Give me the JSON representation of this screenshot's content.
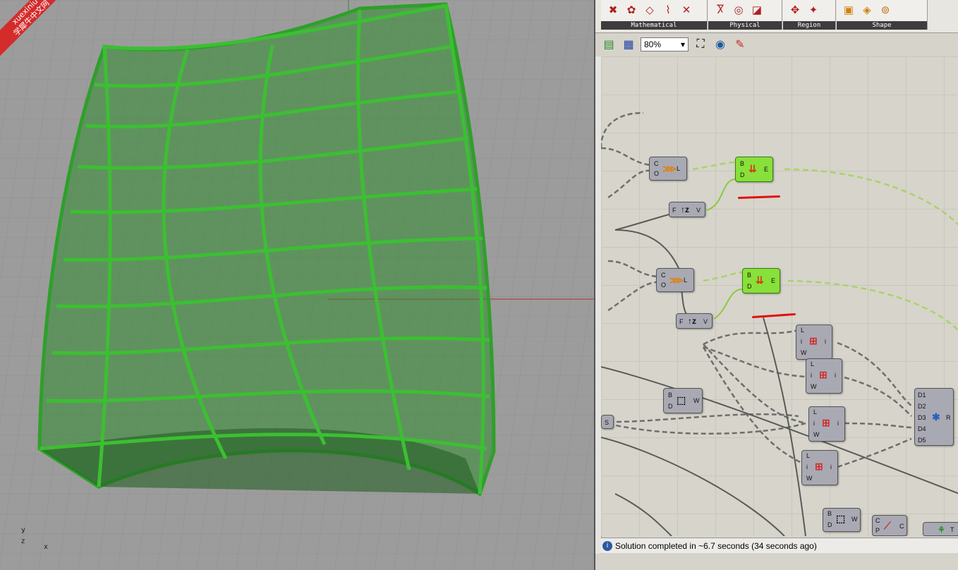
{
  "watermark": {
    "line1": "xuexiniu",
    "line2": "学犀牛中文网"
  },
  "viewport": {
    "axis_y": "y",
    "axis_z": "z",
    "axis_x": "x"
  },
  "ribbon": {
    "groups": [
      {
        "label": "Mathematical",
        "icons": [
          "bounce-icon",
          "hinge-icon",
          "plane-icon",
          "angle-icon",
          "hinge2-icon"
        ]
      },
      {
        "label": "Physical",
        "icons": [
          "rope-icon",
          "eye-icon",
          "box-icon"
        ]
      },
      {
        "label": "Region",
        "icons": [
          "region1-icon",
          "region2-icon"
        ]
      },
      {
        "label": "Shape",
        "icons": [
          "cube-icon",
          "box2-icon",
          "circles-icon"
        ]
      }
    ]
  },
  "toolbar": {
    "zoom_value": "80%"
  },
  "components": {
    "anchor1": {
      "in1": "C",
      "in2": "O",
      "out": "L"
    },
    "anchor2": {
      "in1": "C",
      "in2": "O",
      "out": "L"
    },
    "unitz1": {
      "in": "F",
      "out": "V"
    },
    "unitz2": {
      "in": "F",
      "out": "V"
    },
    "load1": {
      "in1": "B",
      "in2": "D",
      "out": "E"
    },
    "load2": {
      "in1": "B",
      "in2": "D",
      "out": "E"
    },
    "box1": {
      "in1": "B",
      "in2": "D",
      "out": "W"
    },
    "box2": {
      "in1": "B",
      "in2": "D",
      "out": "W"
    },
    "interp1": {
      "in1": "L",
      "in2": "i",
      "in3": "W",
      "out": "i"
    },
    "interp2": {
      "in1": "L",
      "in2": "i",
      "in3": "W",
      "out": "i"
    },
    "interp3": {
      "in1": "L",
      "in2": "i",
      "in3": "W",
      "out": "i"
    },
    "interp4": {
      "in1": "L",
      "in2": "i",
      "in3": "W",
      "out": "i"
    },
    "merge": {
      "in1": "D1",
      "in2": "D2",
      "in3": "D3",
      "in4": "D4",
      "in5": "D5",
      "out": "R"
    },
    "s_param": {
      "label": "S"
    },
    "bottom1": {
      "in1": "C",
      "in2": "P",
      "out": "C"
    },
    "bottom2": {
      "out": "T"
    }
  },
  "status": {
    "text": "Solution completed in ~6.7 seconds (34 seconds ago)"
  },
  "colors": {
    "green_shell": "#2fa12a",
    "component_green": "#88e03a",
    "wire_green": "#8cc93c"
  }
}
